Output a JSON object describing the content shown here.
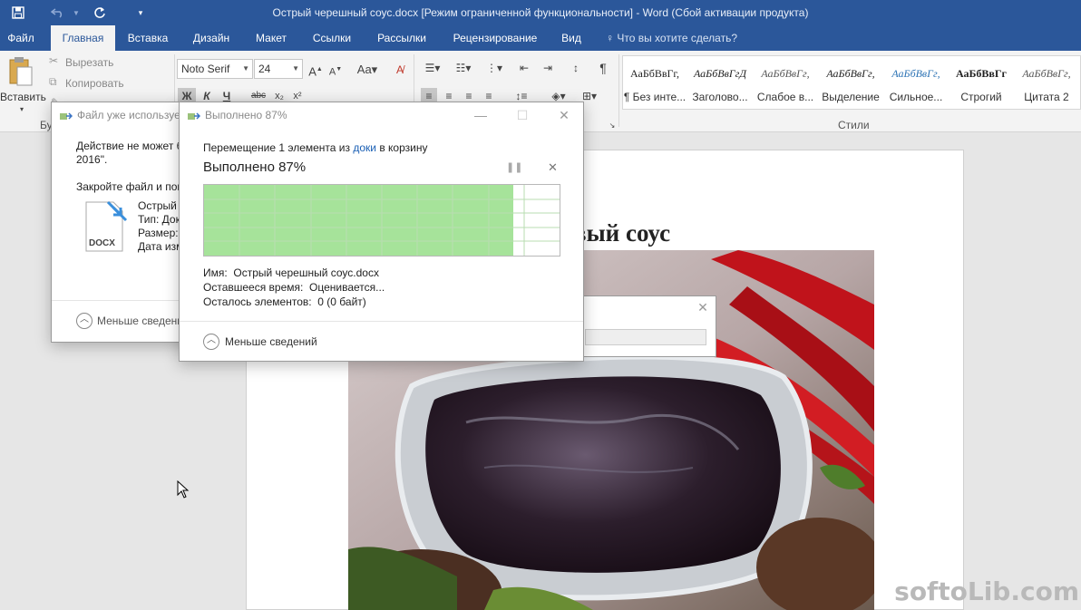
{
  "titlebar": {
    "title": "Острый черешный соус.docx [Режим ограниченной функциональности] - Word (Сбой активации продукта)",
    "qa_icons": [
      "save-icon",
      "undo-icon",
      "redo-icon",
      "customize-icon"
    ]
  },
  "tabs": [
    {
      "label": "Файл"
    },
    {
      "label": "Главная"
    },
    {
      "label": "Вставка"
    },
    {
      "label": "Дизайн"
    },
    {
      "label": "Макет"
    },
    {
      "label": "Ссылки"
    },
    {
      "label": "Рассылки"
    },
    {
      "label": "Рецензирование"
    },
    {
      "label": "Вид"
    }
  ],
  "active_tab": "Главная",
  "tellme": "Что вы хотите сделать?",
  "ribbon": {
    "paste_label": "Вставить",
    "cut_label": "Вырезать",
    "copy_label": "Копировать",
    "clipboard_group": "Бу",
    "font_name": "Noto Serif",
    "font_size": "24",
    "format_btns": [
      "Ж",
      "К",
      "Ч",
      "abc",
      "x₂",
      "x²"
    ],
    "styles_group": "Стили",
    "styles": [
      {
        "sample": "АаБбВвГг,",
        "name": "¶ Без инте..."
      },
      {
        "sample": "АаБбВвГгД",
        "name": "Заголово..."
      },
      {
        "sample": "АаБбВвГг,",
        "name": "Слабое в..."
      },
      {
        "sample": "АаБбВвГг,",
        "name": "Выделение"
      },
      {
        "sample": "АаБбВвГг,",
        "name": "Сильное..."
      },
      {
        "sample": "АаБбВвГг",
        "name": "Строгий"
      },
      {
        "sample": "АаБбВвГг,",
        "name": "Цитата 2"
      }
    ]
  },
  "document": {
    "heading_visible": "вый соус"
  },
  "back_dialog": {
    "title": "Файл уже использует",
    "msg_line1": "Действие не может б",
    "msg_line2": "2016\".",
    "msg_line3": "Закройте файл и пов",
    "file_label_name": "Острый",
    "file_label_type": "Тип: Док",
    "file_label_size": "Размер:",
    "file_label_date": "Дата изм",
    "docx_badge": "DOCX",
    "less_details": "Меньше сведени"
  },
  "progress_dialog": {
    "title": "Выполнено 87%",
    "moving_prefix": "Перемещение 1 элемента из",
    "moving_link": "доки",
    "moving_suffix": "в корзину",
    "status": "Выполнено 87%",
    "progress": 0.87,
    "name_label": "Имя:",
    "name_value": "Острый черешный соус.docx",
    "time_label": "Оставшееся время:",
    "time_value": "Оценивается...",
    "items_label": "Осталось элементов:",
    "items_value": "0 (0 байт)",
    "less_details": "Меньше сведений",
    "fill_color": "#a6e39a"
  },
  "watermark": "softoLib.com"
}
